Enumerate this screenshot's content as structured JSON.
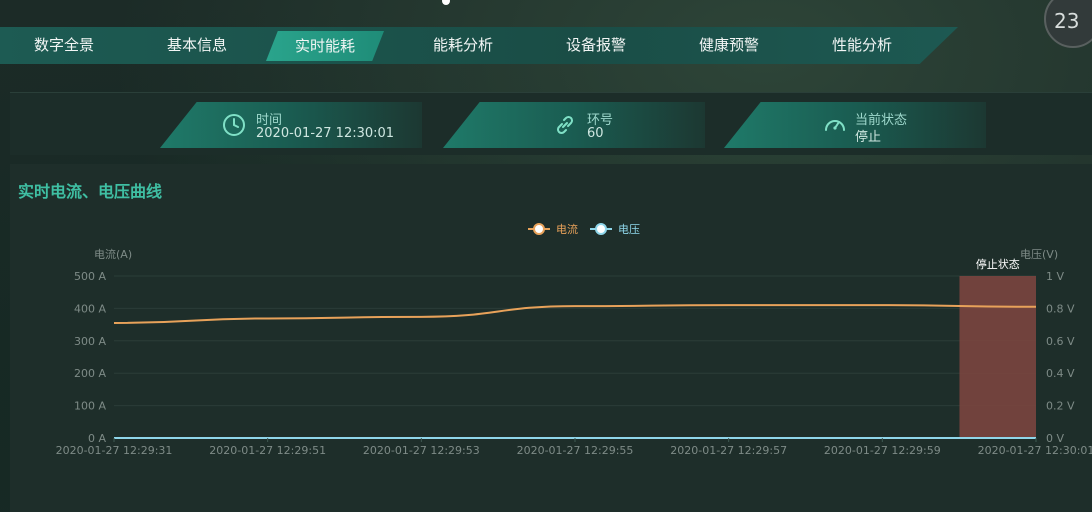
{
  "nav": {
    "items": [
      {
        "label": "数字全景"
      },
      {
        "label": "基本信息"
      },
      {
        "label": "实时能耗"
      },
      {
        "label": "能耗分析"
      },
      {
        "label": "设备报警"
      },
      {
        "label": "健康预警"
      },
      {
        "label": "性能分析"
      }
    ],
    "active_index": 2
  },
  "badge": "23",
  "info": {
    "time": {
      "label": "时间",
      "value": "2020-01-27 12:30:01",
      "icon": "clock-icon"
    },
    "ring": {
      "label": "环号",
      "value": "60",
      "icon": "link-icon"
    },
    "status": {
      "label": "当前状态",
      "value": "停止",
      "icon": "speedometer-icon"
    }
  },
  "panel": {
    "title": "实时电流、电压曲线"
  },
  "chart_data": {
    "type": "line",
    "legend": [
      "电流",
      "电压"
    ],
    "legend_position": "top-center",
    "x": [
      "2020-01-27 12:29:31",
      "2020-01-27 12:29:51",
      "2020-01-27 12:29:53",
      "2020-01-27 12:29:55",
      "2020-01-27 12:29:57",
      "2020-01-27 12:29:59",
      "2020-01-27 12:30:01"
    ],
    "series": [
      {
        "name": "电流",
        "axis": "left",
        "color": "#e8a25a",
        "values": [
          355,
          369,
          374,
          407,
          410,
          410,
          405
        ]
      },
      {
        "name": "电压",
        "axis": "right",
        "color": "#8fd6ea",
        "values": [
          0,
          0,
          0,
          0,
          0,
          0,
          0
        ]
      }
    ],
    "left_axis": {
      "label": "电流(A)",
      "min": 0,
      "max": 500,
      "ticks": [
        "0 A",
        "100 A",
        "200 A",
        "300 A",
        "400 A",
        "500 A"
      ]
    },
    "right_axis": {
      "label": "电压(V)",
      "min": 0,
      "max": 1,
      "ticks": [
        "0 V",
        "0.2 V",
        "0.4 V",
        "0.6 V",
        "0.8 V",
        "1 V"
      ]
    },
    "highlight": {
      "label": "停止状态",
      "from_fraction": 0.917,
      "to_fraction": 1.0,
      "color": "#7a453f"
    },
    "grid": true
  }
}
